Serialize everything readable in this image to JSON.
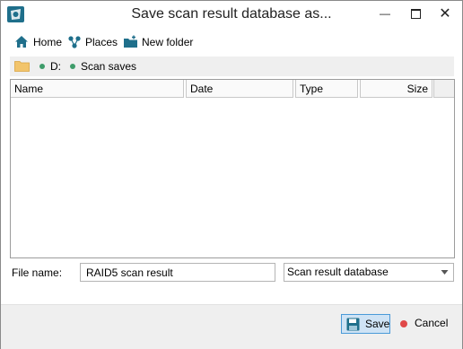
{
  "window": {
    "title": "Save scan result database as..."
  },
  "toolbar": {
    "home_label": "Home",
    "places_label": "Places",
    "new_folder_label": "New folder"
  },
  "path": {
    "drive": "D:",
    "folder": "Scan saves"
  },
  "list": {
    "columns": [
      "Name",
      "Date",
      "Type",
      "Size"
    ]
  },
  "file_name": {
    "label": "File name:",
    "value": "RAID5 scan result"
  },
  "file_type": {
    "value": "Scan result database"
  },
  "buttons": {
    "save_label": "Save",
    "cancel_label": "Cancel"
  },
  "colors": {
    "accent": "#4a9ad8",
    "button_bg": "#cfe3f5",
    "icon": "#1f6f8b",
    "dot_green": "#3e9c6a",
    "cancel_red": "#e04848"
  }
}
